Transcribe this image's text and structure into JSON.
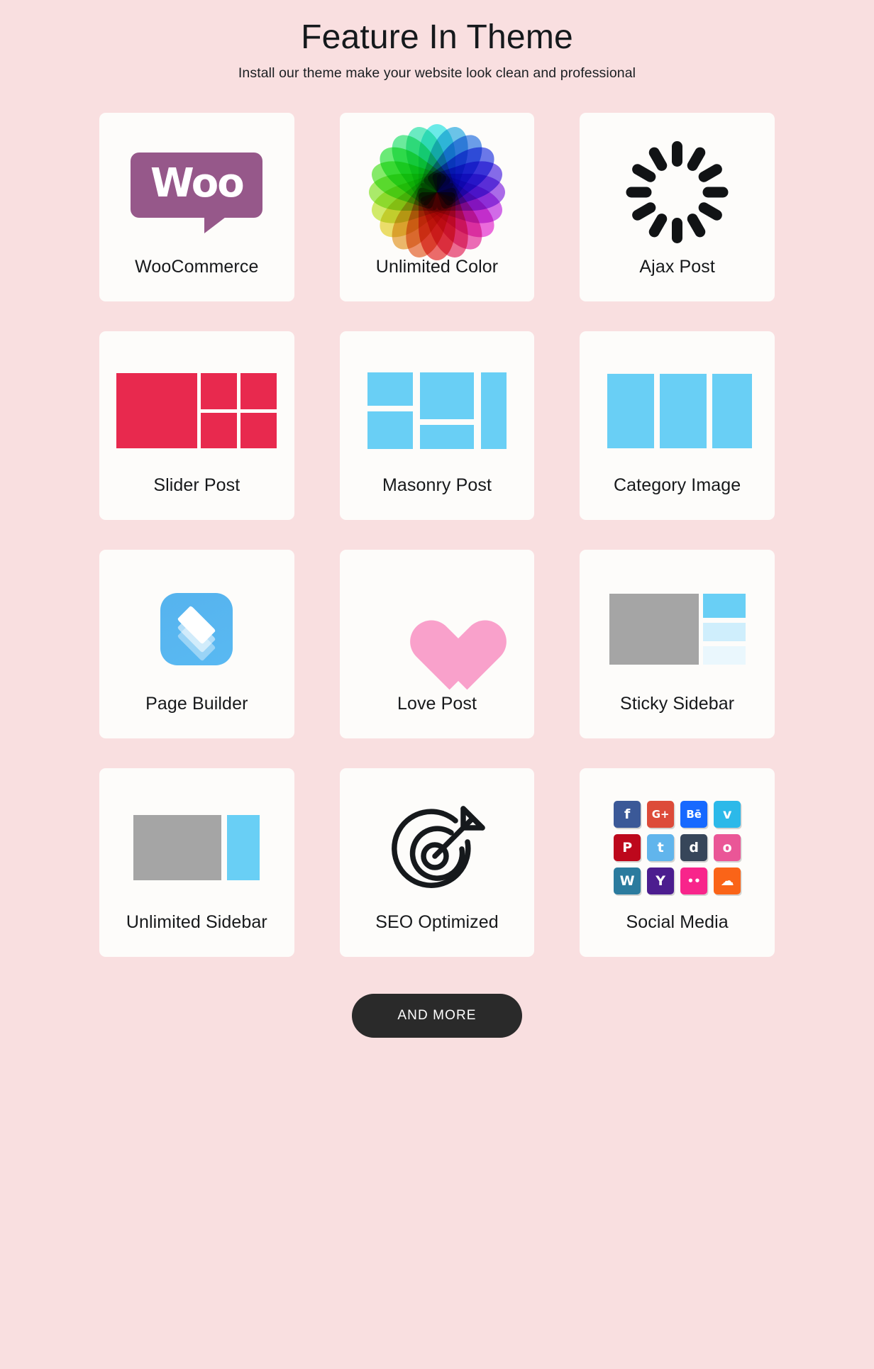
{
  "header": {
    "title": "Feature In Theme",
    "subtitle": "Install our theme make your website look clean and professional"
  },
  "theme": {
    "background": "#f9dfe0",
    "card_background": "#fdfcfa",
    "text": "#17191b",
    "accent_blue": "#69cff5",
    "accent_red": "#e8294e",
    "accent_gray": "#a5a5a5",
    "accent_pink": "#f9a1cb",
    "woo_purple": "#96588a",
    "button_background": "#2a2a2a",
    "button_text": "#ffffff"
  },
  "features": [
    {
      "label": "WooCommerce",
      "icon": "woocommerce-logo-icon",
      "logo_text": "Woo"
    },
    {
      "label": "Unlimited Color",
      "icon": "color-wheel-icon"
    },
    {
      "label": "Ajax Post",
      "icon": "loading-spinner-icon"
    },
    {
      "label": "Slider Post",
      "icon": "slider-layout-icon"
    },
    {
      "label": "Masonry Post",
      "icon": "masonry-layout-icon"
    },
    {
      "label": "Category Image",
      "icon": "category-columns-icon"
    },
    {
      "label": "Page Builder",
      "icon": "stacked-layers-icon"
    },
    {
      "label": "Love Post",
      "icon": "heart-icon"
    },
    {
      "label": "Sticky Sidebar",
      "icon": "sticky-sidebar-layout-icon"
    },
    {
      "label": "Unlimited Sidebar",
      "icon": "sidebar-layout-icon"
    },
    {
      "label": "SEO Optimized",
      "icon": "target-dart-icon"
    },
    {
      "label": "Social Media",
      "icon": "social-icons-grid-icon"
    }
  ],
  "social_icons": [
    {
      "name": "facebook-icon",
      "glyph": "f",
      "color": "#3b5998"
    },
    {
      "name": "google-plus-icon",
      "glyph": "G+",
      "color": "#dd4b39"
    },
    {
      "name": "behance-icon",
      "glyph": "Bē",
      "color": "#1769ff"
    },
    {
      "name": "vimeo-icon",
      "glyph": "v",
      "color": "#2cb9e9"
    },
    {
      "name": "pinterest-icon",
      "glyph": "P",
      "color": "#bd081c"
    },
    {
      "name": "twitter-icon",
      "glyph": "t",
      "color": "#61b5ec"
    },
    {
      "name": "deviantart-icon",
      "glyph": "d",
      "color": "#37465a"
    },
    {
      "name": "dribbble-icon",
      "glyph": "o",
      "color": "#ea5697"
    },
    {
      "name": "wordpress-icon",
      "glyph": "W",
      "color": "#2b7b9e"
    },
    {
      "name": "ycombinator-icon",
      "glyph": "Y",
      "color": "#4c1d8f"
    },
    {
      "name": "flickr-icon",
      "glyph": "••",
      "color": "#f8258b"
    },
    {
      "name": "soundcloud-icon",
      "glyph": "☁",
      "color": "#fa6418"
    }
  ],
  "footer": {
    "more_button_label": "AND MORE"
  },
  "color_wheel_hues": [
    0,
    18,
    36,
    54,
    72,
    90,
    108,
    126,
    144,
    162,
    180,
    198,
    216,
    234,
    252,
    270,
    288,
    306,
    324,
    342
  ]
}
